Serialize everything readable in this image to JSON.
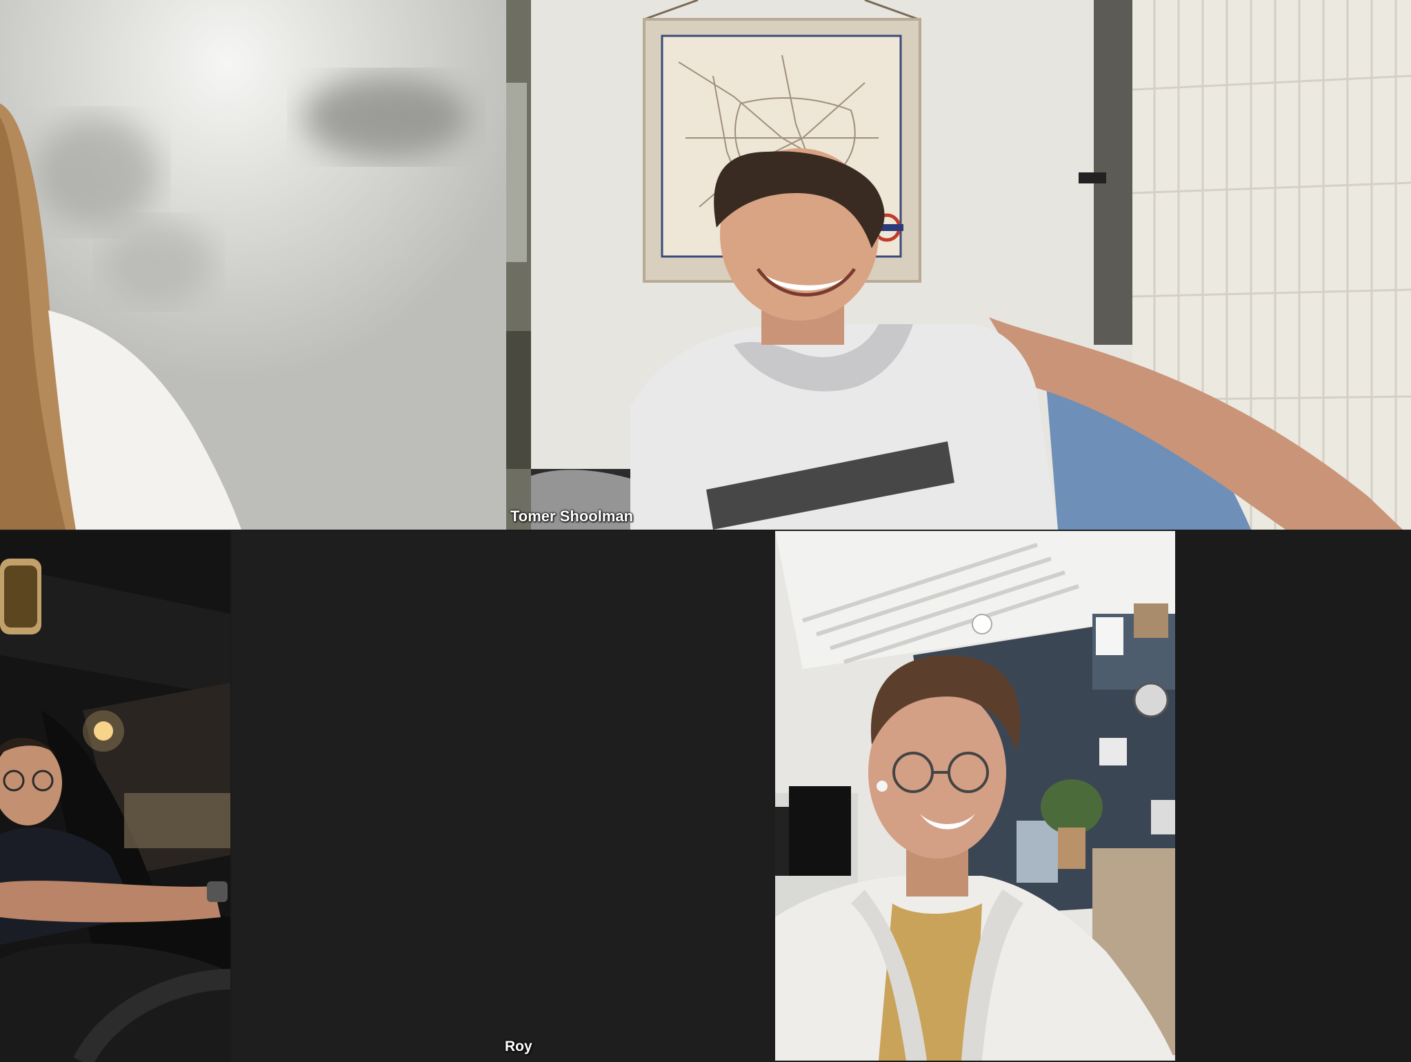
{
  "participants": {
    "tomer": {
      "name": "Tomer Shoolman"
    },
    "roy": {
      "name": "Roy"
    }
  },
  "colors": {
    "grid_background": "#1b1b1b",
    "name_label": "#ffffff"
  }
}
